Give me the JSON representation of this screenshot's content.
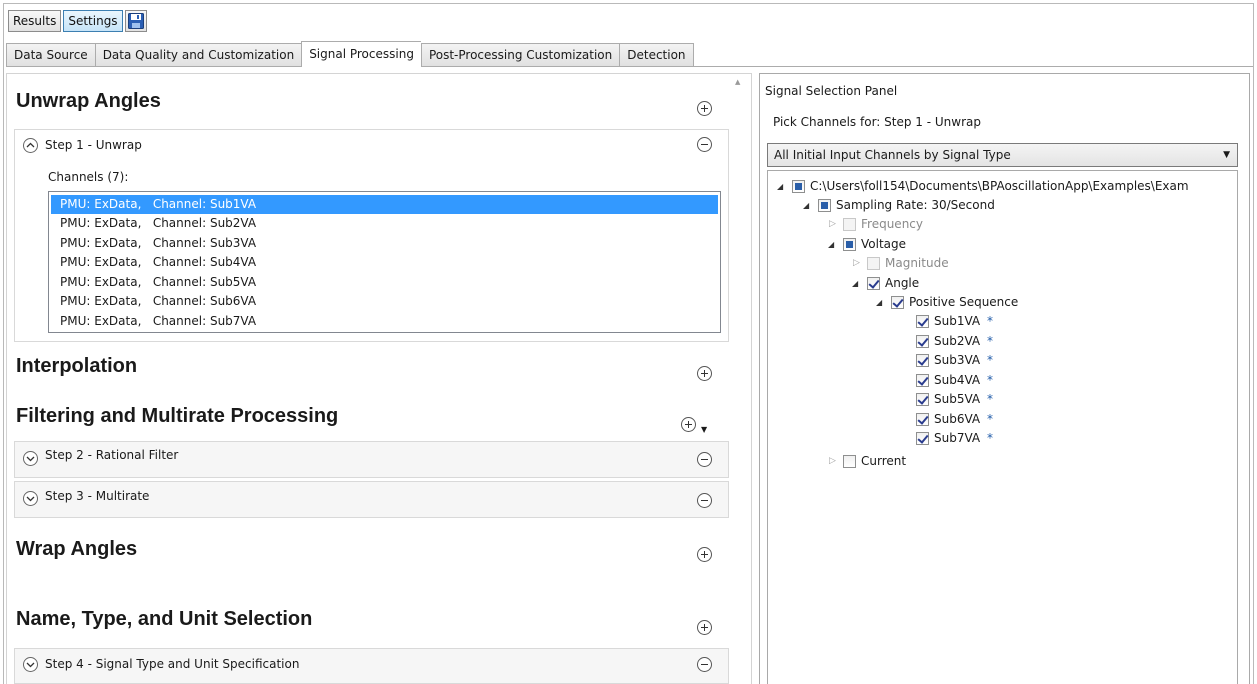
{
  "toolbar": {
    "results_label": "Results",
    "settings_label": "Settings"
  },
  "tabs": [
    "Data Source",
    "Data Quality and Customization",
    "Signal Processing",
    "Post-Processing Customization",
    "Detection"
  ],
  "active_tab": "Signal Processing",
  "left": {
    "unwrap_heading": "Unwrap Angles",
    "step1_label": "Step 1 - Unwrap",
    "channels_label": "Channels (7):",
    "channels": [
      "PMU: ExData,   Channel: Sub1VA",
      "PMU: ExData,   Channel: Sub2VA",
      "PMU: ExData,   Channel: Sub3VA",
      "PMU: ExData,   Channel: Sub4VA",
      "PMU: ExData,   Channel: Sub5VA",
      "PMU: ExData,   Channel: Sub6VA",
      "PMU: ExData,   Channel: Sub7VA"
    ],
    "selected_channel_index": 0,
    "interpolation_heading": "Interpolation",
    "filtering_heading": "Filtering and Multirate Processing",
    "step2_label": "Step 2 - Rational Filter",
    "step3_label": "Step 3 - Multirate",
    "wrap_heading": "Wrap Angles",
    "name_heading": "Name, Type, and Unit Selection",
    "step4_label": "Step 4 - Signal Type and Unit Specification"
  },
  "right": {
    "panel_title": "Signal Selection Panel",
    "pick_label": "Pick Channels for: Step 1 - Unwrap",
    "combo_value": "All Initial Input Channels by Signal Type",
    "tree": {
      "root": "C:\\Users\\foll154\\Documents\\BPAoscillationApp\\Examples\\Exam",
      "sampling": "Sampling Rate: 30/Second",
      "frequency": "Frequency",
      "voltage": "Voltage",
      "magnitude": "Magnitude",
      "angle": "Angle",
      "positive_sequence": "Positive Sequence",
      "signals": [
        "Sub1VA",
        "Sub2VA",
        "Sub3VA",
        "Sub4VA",
        "Sub5VA",
        "Sub6VA",
        "Sub7VA"
      ],
      "signal_marker": "*",
      "current": "Current"
    }
  },
  "colors": {
    "selection": "#3399ff",
    "tab_active": "#ffffff",
    "check_mark": "#2a3c8e"
  }
}
